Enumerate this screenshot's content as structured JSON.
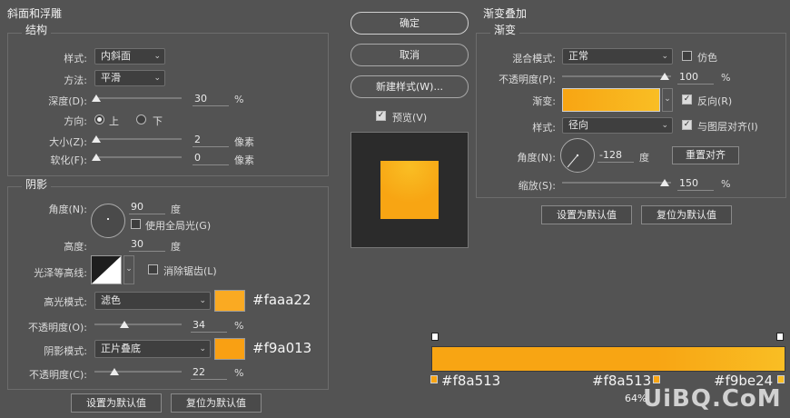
{
  "bevel": {
    "title": "斜面和浮雕",
    "structure": {
      "title": "结构",
      "style_label": "样式:",
      "style_value": "内斜面",
      "technique_label": "方法:",
      "technique_value": "平滑",
      "depth_label": "深度(D):",
      "depth_value": "30",
      "depth_unit": "%",
      "direction_label": "方向:",
      "direction_up": "上",
      "direction_down": "下",
      "size_label": "大小(Z):",
      "size_value": "2",
      "size_unit": "像素",
      "soften_label": "软化(F):",
      "soften_value": "0",
      "soften_unit": "像素"
    },
    "shading": {
      "title": "阴影",
      "angle_label": "角度(N):",
      "angle_value": "90",
      "angle_unit": "度",
      "global_light_label": "使用全局光(G)",
      "altitude_label": "高度:",
      "altitude_value": "30",
      "altitude_unit": "度",
      "gloss_label": "光泽等高线:",
      "antialias_label": "消除锯齿(L)",
      "highlight_label": "高光模式:",
      "highlight_value": "滤色",
      "highlight_color": "#faaa22",
      "highlight_hex": "#faaa22",
      "highlight_opacity_label": "不透明度(O):",
      "highlight_opacity_value": "34",
      "highlight_opacity_unit": "%",
      "shadow_label": "阴影模式:",
      "shadow_value": "正片叠底",
      "shadow_color": "#f9a013",
      "shadow_hex": "#f9a013",
      "shadow_opacity_label": "不透明度(C):",
      "shadow_opacity_value": "22",
      "shadow_opacity_unit": "%"
    },
    "make_default": "设置为默认值",
    "reset_default": "复位为默认值"
  },
  "center": {
    "ok": "确定",
    "cancel": "取消",
    "new_style": "新建样式(W)...",
    "preview_label": "预览(V)"
  },
  "gradient_overlay": {
    "title": "渐变叠加",
    "gradient": {
      "title": "渐变",
      "blend_label": "混合模式:",
      "blend_value": "正常",
      "dither_label": "仿色",
      "opacity_label": "不透明度(P):",
      "opacity_value": "100",
      "opacity_unit": "%",
      "gradient_label": "渐变:",
      "reverse_label": "反向(R)",
      "style_label": "样式:",
      "style_value": "径向",
      "align_label": "与图层对齐(I)",
      "angle_label": "角度(N):",
      "angle_value": "-128",
      "angle_unit": "度",
      "reset_align": "重置对齐",
      "scale_label": "缩放(S):",
      "scale_value": "150",
      "scale_unit": "%"
    },
    "make_default": "设置为默认值",
    "reset_default": "复位为默认值"
  },
  "gradient_editor": {
    "stop_left_hex": "#f8a513",
    "stop_mid_hex": "#f8a513",
    "stop_right_hex": "#f9be24",
    "mid_location": "64%",
    "colors": [
      "#f8a513",
      "#f9be24"
    ]
  },
  "watermark": "UiBQ.CoM"
}
